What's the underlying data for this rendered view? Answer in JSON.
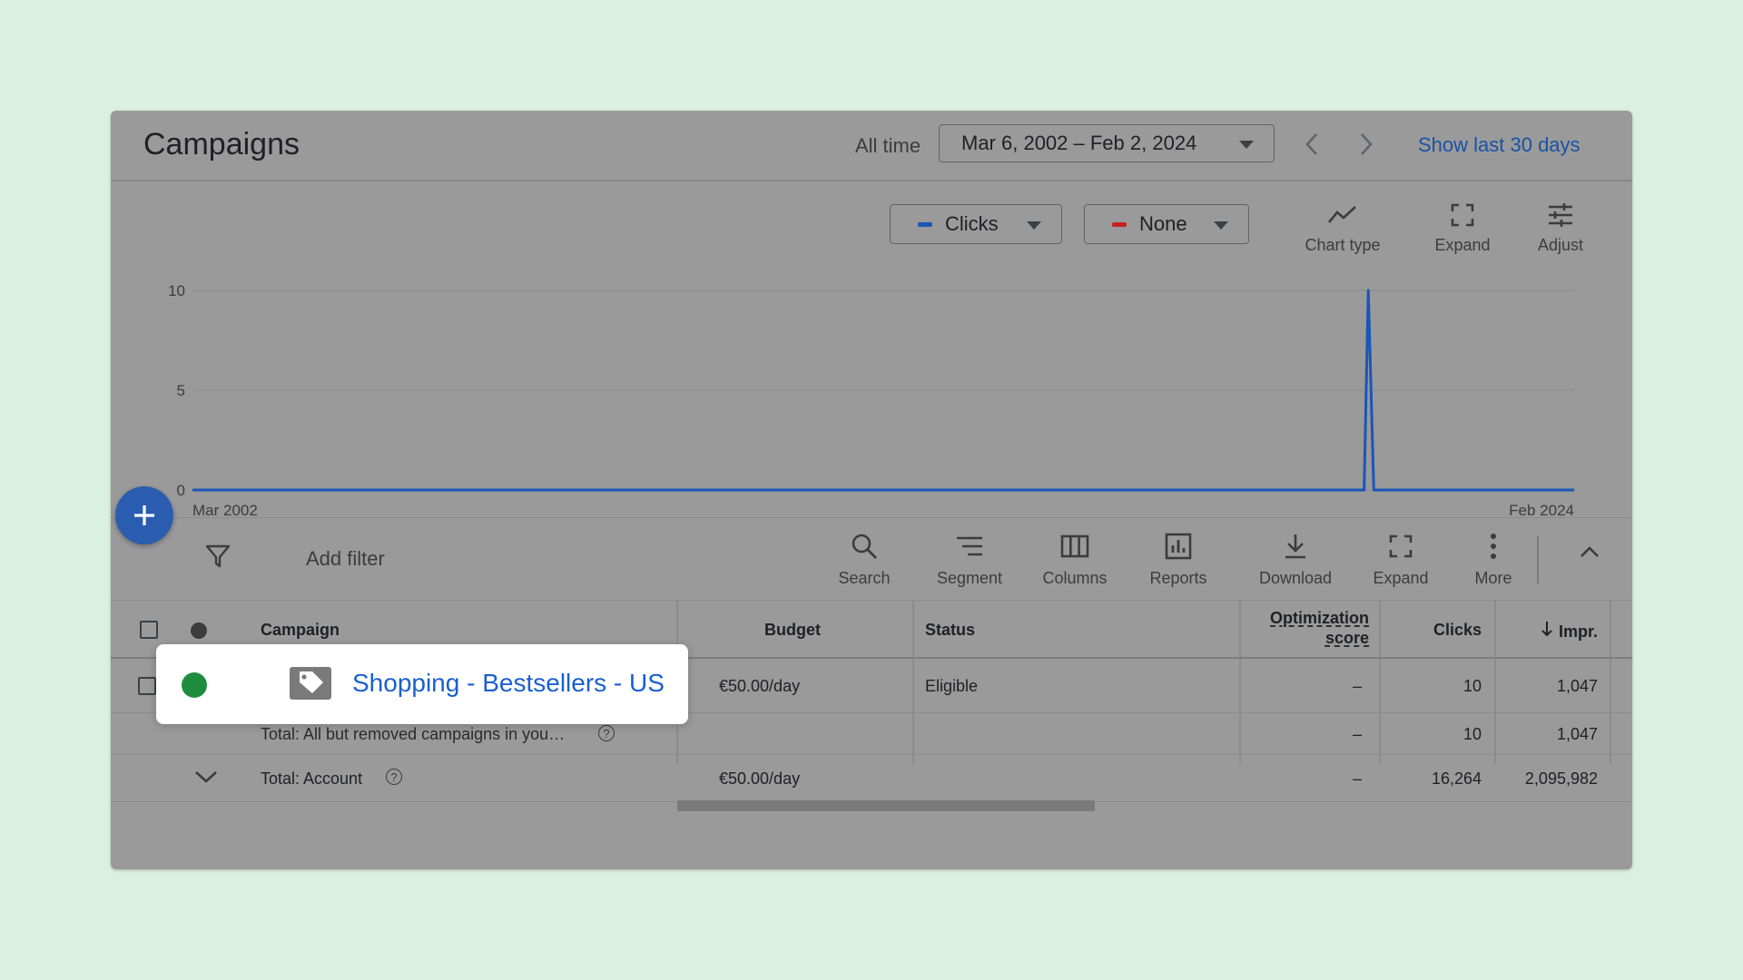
{
  "header": {
    "title": "Campaigns",
    "range_label": "All time",
    "date_range": "Mar 6, 2002 – Feb 2, 2024",
    "show_last": "Show last 30 days"
  },
  "chart_controls": {
    "metric1": {
      "label": "Clicks",
      "color": "#1a56b8"
    },
    "metric2": {
      "label": "None",
      "color": "#c5221f"
    },
    "tools": [
      {
        "label": "Chart type",
        "icon": "chart-type-icon"
      },
      {
        "label": "Expand",
        "icon": "expand-icon"
      },
      {
        "label": "Adjust",
        "icon": "adjust-icon"
      }
    ]
  },
  "chart_data": {
    "type": "line",
    "x_start_label": "Mar 2002",
    "x_end_label": "Feb 2024",
    "ylim": [
      0,
      10
    ],
    "y_ticks": [
      0,
      5,
      10
    ],
    "grid": true,
    "series": [
      {
        "color": "#1a56b8",
        "points": [
          [
            0.0,
            0
          ],
          [
            0.848,
            0
          ],
          [
            0.851,
            10
          ],
          [
            0.855,
            0
          ],
          [
            1.0,
            0
          ]
        ]
      }
    ]
  },
  "toolbar": {
    "add_filter": "Add filter",
    "tools": [
      {
        "label": "Search",
        "icon": "search-icon"
      },
      {
        "label": "Segment",
        "icon": "segment-icon"
      },
      {
        "label": "Columns",
        "icon": "columns-icon"
      },
      {
        "label": "Reports",
        "icon": "reports-icon"
      },
      {
        "label": "Download",
        "icon": "download-icon"
      },
      {
        "label": "Expand",
        "icon": "expand-icon"
      },
      {
        "label": "More",
        "icon": "more-vert-icon"
      }
    ]
  },
  "table": {
    "columns": {
      "campaign": "Campaign",
      "budget": "Budget",
      "status": "Status",
      "optimization_line1": "Optimization",
      "optimization_line2": "score",
      "clicks": "Clicks",
      "impr": "Impr."
    },
    "rows": [
      {
        "campaign": "Shopping - Bestsellers - US",
        "budget": "€50.00/day",
        "status": "Eligible",
        "optimization": "–",
        "clicks": "10",
        "impr": "1,047"
      }
    ],
    "total_filtered": {
      "label": "Total: All but removed campaigns in you…",
      "optimization": "–",
      "clicks": "10",
      "impr": "1,047"
    },
    "total_account": {
      "label": "Total: Account",
      "budget": "€50.00/day",
      "optimization": "–",
      "clicks": "16,264",
      "impr": "2,095,982"
    }
  },
  "colors": {
    "status_enabled": "#1e8e3e",
    "link": "#1a5fd0",
    "accent": "#2a5db0"
  }
}
